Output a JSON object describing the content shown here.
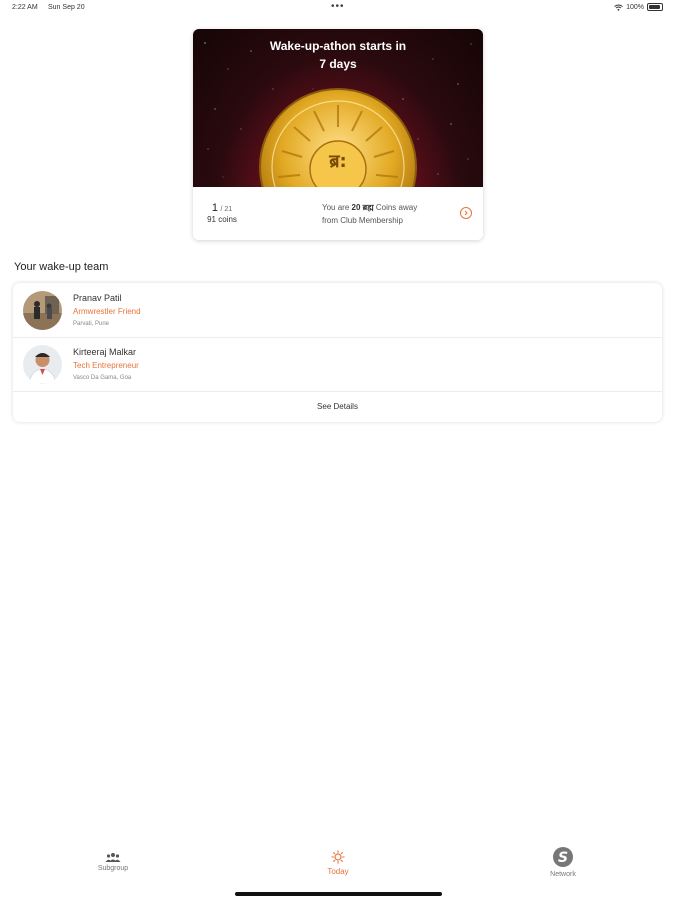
{
  "status_bar": {
    "time": "2:22 AM",
    "date": "Sun Sep 20",
    "dots": "•••",
    "battery": "100%"
  },
  "event": {
    "title_line1": "Wake-up-athon starts in",
    "title_line2": "7 days",
    "coin_symbol": "ब्र:",
    "progress_current": "1",
    "progress_total": "/ 21",
    "coins_label": "91 coins",
    "away_prefix": "You are ",
    "away_amount": "20 ब्रह्म",
    "away_suffix": " Coins away",
    "away_line2": "from Club Membership"
  },
  "team": {
    "title": "Your wake-up team",
    "members": [
      {
        "name": "Pranav Patil",
        "role": "Armwrestler Friend",
        "location": "Parvati, Pune"
      },
      {
        "name": "Kirteeraj Malkar",
        "role": "Tech Entrepreneur",
        "location": "Vasco Da Gama, Goa"
      }
    ],
    "see_details": "See Details"
  },
  "tabs": [
    {
      "label": "Subgroup",
      "icon": "people-icon"
    },
    {
      "label": "Today",
      "icon": "sun-icon"
    },
    {
      "label": "Network",
      "icon": "network-s-icon"
    }
  ],
  "colors": {
    "accent": "#e8733a",
    "hero_dark": "#150506",
    "hero_red": "#a6192e",
    "coin_gold": "#e2a923"
  }
}
